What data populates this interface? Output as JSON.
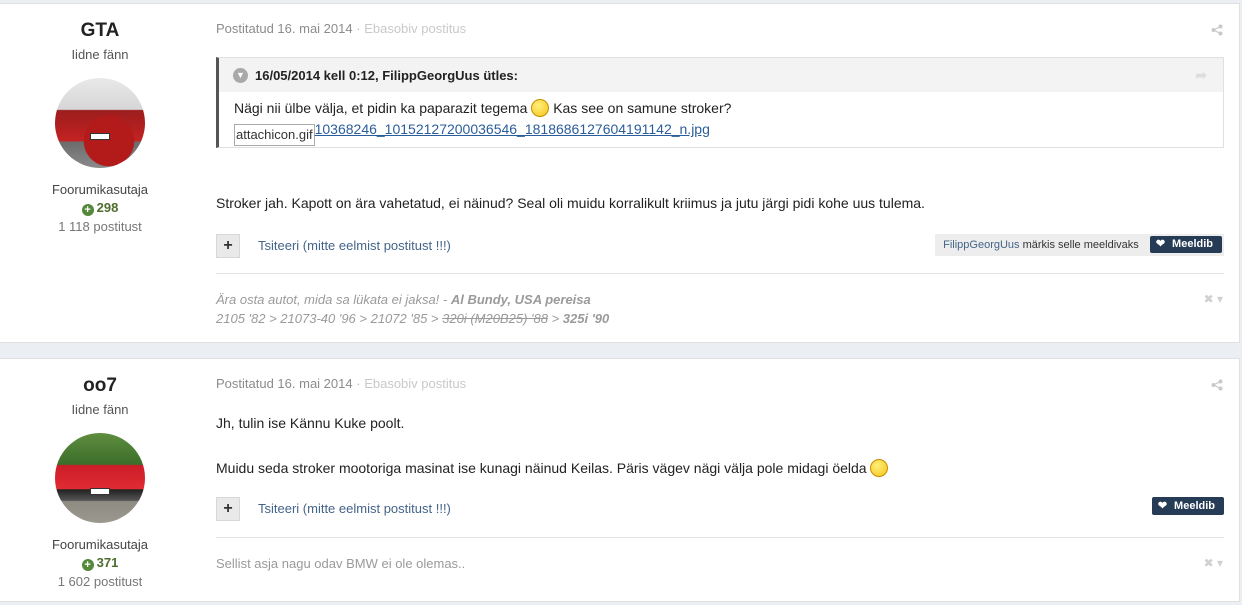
{
  "post1": {
    "author": {
      "name": "GTA",
      "title": "Iidne fänn",
      "group": "Foorumikasutaja",
      "reputation": "298",
      "posts": "1 118 postitust"
    },
    "meta": {
      "posted": "Postitatud 16. mai 2014",
      "separator": "·",
      "report": "Ebasobiv postitus"
    },
    "quote": {
      "header": "16/05/2014 kell 0:12, FilippGeorgUus ütles:",
      "text_before": "Nägi nii ülbe välja, et pidin ka paparazit tegema",
      "text_after": "Kas see on samune stroker?",
      "img_alt": "attachicon.gif",
      "link": "10368246_10152127200036546_1818686127604191142_n.jpg"
    },
    "body": "Stroker jah. Kapott on ära vahetatud, ei näinud? Seal oli muidu korralikult kriimus ja jutu järgi pidi kohe uus tulema.",
    "actions": {
      "plus": "+",
      "quote_label": "Tsiteeri (mitte eelmist postitust !!!)",
      "liker": "FilippGeorgUus",
      "liked_text": "märkis selle meeldivaks",
      "like_label": "Meeldib"
    },
    "signature": {
      "line1_text": "Ära osta autot, mida sa lükata ei jaksa! - ",
      "line1_bold": "Al Bundy, USA pereisa",
      "line2_a": "2105 '82 > 21073-40 '96 > 21072 '85  > ",
      "line2_strike": "320i (M20B25) '88",
      "line2_b": " > ",
      "line2_last": "325i '90"
    }
  },
  "post2": {
    "author": {
      "name": "oo7",
      "title": "Iidne fänn",
      "group": "Foorumikasutaja",
      "reputation": "371",
      "posts": "1 602 postitust"
    },
    "meta": {
      "posted": "Postitatud 16. mai 2014",
      "separator": "·",
      "report": "Ebasobiv postitus"
    },
    "body_line1": "Jh, tulin ise Kännu Kuke poolt.",
    "body_line2": "Muidu seda stroker mootoriga masinat ise kunagi näinud Keilas. Päris vägev nägi välja pole midagi öelda",
    "actions": {
      "plus": "+",
      "quote_label": "Tsiteeri (mitte eelmist postitust !!!)",
      "like_label": "Meeldib"
    },
    "signature": {
      "text": "Sellist asja nagu odav BMW ei ole olemas.."
    }
  }
}
